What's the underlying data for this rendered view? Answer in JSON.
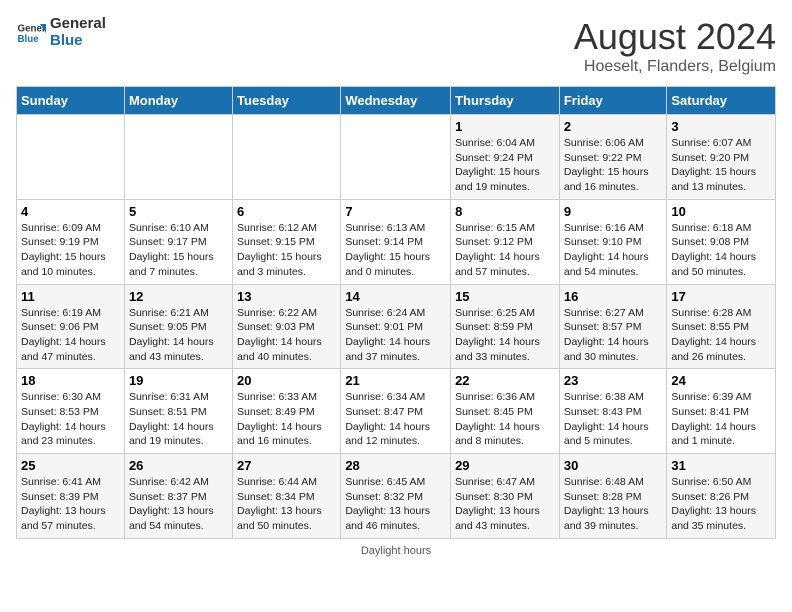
{
  "logo": {
    "line1": "General",
    "line2": "Blue"
  },
  "title": "August 2024",
  "subtitle": "Hoeselt, Flanders, Belgium",
  "days_of_week": [
    "Sunday",
    "Monday",
    "Tuesday",
    "Wednesday",
    "Thursday",
    "Friday",
    "Saturday"
  ],
  "weeks": [
    [
      {
        "num": "",
        "detail": ""
      },
      {
        "num": "",
        "detail": ""
      },
      {
        "num": "",
        "detail": ""
      },
      {
        "num": "",
        "detail": ""
      },
      {
        "num": "1",
        "detail": "Sunrise: 6:04 AM\nSunset: 9:24 PM\nDaylight: 15 hours\nand 19 minutes."
      },
      {
        "num": "2",
        "detail": "Sunrise: 6:06 AM\nSunset: 9:22 PM\nDaylight: 15 hours\nand 16 minutes."
      },
      {
        "num": "3",
        "detail": "Sunrise: 6:07 AM\nSunset: 9:20 PM\nDaylight: 15 hours\nand 13 minutes."
      }
    ],
    [
      {
        "num": "4",
        "detail": "Sunrise: 6:09 AM\nSunset: 9:19 PM\nDaylight: 15 hours\nand 10 minutes."
      },
      {
        "num": "5",
        "detail": "Sunrise: 6:10 AM\nSunset: 9:17 PM\nDaylight: 15 hours\nand 7 minutes."
      },
      {
        "num": "6",
        "detail": "Sunrise: 6:12 AM\nSunset: 9:15 PM\nDaylight: 15 hours\nand 3 minutes."
      },
      {
        "num": "7",
        "detail": "Sunrise: 6:13 AM\nSunset: 9:14 PM\nDaylight: 15 hours\nand 0 minutes."
      },
      {
        "num": "8",
        "detail": "Sunrise: 6:15 AM\nSunset: 9:12 PM\nDaylight: 14 hours\nand 57 minutes."
      },
      {
        "num": "9",
        "detail": "Sunrise: 6:16 AM\nSunset: 9:10 PM\nDaylight: 14 hours\nand 54 minutes."
      },
      {
        "num": "10",
        "detail": "Sunrise: 6:18 AM\nSunset: 9:08 PM\nDaylight: 14 hours\nand 50 minutes."
      }
    ],
    [
      {
        "num": "11",
        "detail": "Sunrise: 6:19 AM\nSunset: 9:06 PM\nDaylight: 14 hours\nand 47 minutes."
      },
      {
        "num": "12",
        "detail": "Sunrise: 6:21 AM\nSunset: 9:05 PM\nDaylight: 14 hours\nand 43 minutes."
      },
      {
        "num": "13",
        "detail": "Sunrise: 6:22 AM\nSunset: 9:03 PM\nDaylight: 14 hours\nand 40 minutes."
      },
      {
        "num": "14",
        "detail": "Sunrise: 6:24 AM\nSunset: 9:01 PM\nDaylight: 14 hours\nand 37 minutes."
      },
      {
        "num": "15",
        "detail": "Sunrise: 6:25 AM\nSunset: 8:59 PM\nDaylight: 14 hours\nand 33 minutes."
      },
      {
        "num": "16",
        "detail": "Sunrise: 6:27 AM\nSunset: 8:57 PM\nDaylight: 14 hours\nand 30 minutes."
      },
      {
        "num": "17",
        "detail": "Sunrise: 6:28 AM\nSunset: 8:55 PM\nDaylight: 14 hours\nand 26 minutes."
      }
    ],
    [
      {
        "num": "18",
        "detail": "Sunrise: 6:30 AM\nSunset: 8:53 PM\nDaylight: 14 hours\nand 23 minutes."
      },
      {
        "num": "19",
        "detail": "Sunrise: 6:31 AM\nSunset: 8:51 PM\nDaylight: 14 hours\nand 19 minutes."
      },
      {
        "num": "20",
        "detail": "Sunrise: 6:33 AM\nSunset: 8:49 PM\nDaylight: 14 hours\nand 16 minutes."
      },
      {
        "num": "21",
        "detail": "Sunrise: 6:34 AM\nSunset: 8:47 PM\nDaylight: 14 hours\nand 12 minutes."
      },
      {
        "num": "22",
        "detail": "Sunrise: 6:36 AM\nSunset: 8:45 PM\nDaylight: 14 hours\nand 8 minutes."
      },
      {
        "num": "23",
        "detail": "Sunrise: 6:38 AM\nSunset: 8:43 PM\nDaylight: 14 hours\nand 5 minutes."
      },
      {
        "num": "24",
        "detail": "Sunrise: 6:39 AM\nSunset: 8:41 PM\nDaylight: 14 hours\nand 1 minute."
      }
    ],
    [
      {
        "num": "25",
        "detail": "Sunrise: 6:41 AM\nSunset: 8:39 PM\nDaylight: 13 hours\nand 57 minutes."
      },
      {
        "num": "26",
        "detail": "Sunrise: 6:42 AM\nSunset: 8:37 PM\nDaylight: 13 hours\nand 54 minutes."
      },
      {
        "num": "27",
        "detail": "Sunrise: 6:44 AM\nSunset: 8:34 PM\nDaylight: 13 hours\nand 50 minutes."
      },
      {
        "num": "28",
        "detail": "Sunrise: 6:45 AM\nSunset: 8:32 PM\nDaylight: 13 hours\nand 46 minutes."
      },
      {
        "num": "29",
        "detail": "Sunrise: 6:47 AM\nSunset: 8:30 PM\nDaylight: 13 hours\nand 43 minutes."
      },
      {
        "num": "30",
        "detail": "Sunrise: 6:48 AM\nSunset: 8:28 PM\nDaylight: 13 hours\nand 39 minutes."
      },
      {
        "num": "31",
        "detail": "Sunrise: 6:50 AM\nSunset: 8:26 PM\nDaylight: 13 hours\nand 35 minutes."
      }
    ]
  ],
  "footer": "Daylight hours"
}
